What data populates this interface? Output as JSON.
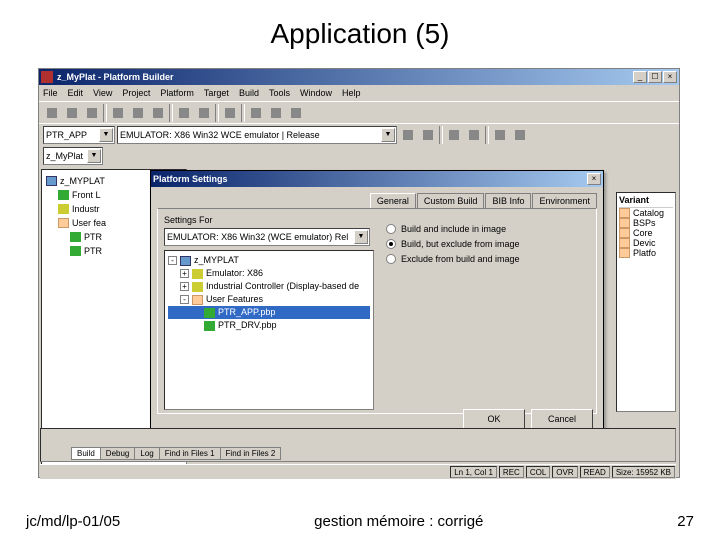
{
  "slide": {
    "title": "Application (5)"
  },
  "footer": {
    "left": "jc/md/lp-01/05",
    "center": "gestion mémoire : corrigé",
    "right": "27"
  },
  "window": {
    "title": "z_MyPlat - Platform Builder",
    "min": "_",
    "max": "☐",
    "close": "×"
  },
  "menu": [
    "File",
    "Edit",
    "View",
    "Project",
    "Platform",
    "Target",
    "Build",
    "Tools",
    "Window",
    "Help"
  ],
  "row2": {
    "left": "PTR_APP",
    "right": "EMULATOR: X86 Win32 WCE emulator | Release"
  },
  "row3": {
    "combo": "z_MyPlat"
  },
  "leftTree": [
    {
      "cls": "",
      "icon": "box",
      "label": "z_MYPLAT"
    },
    {
      "cls": "ind1",
      "icon": "green",
      "label": "Front L"
    },
    {
      "cls": "ind1",
      "icon": "yellow",
      "label": "Industr"
    },
    {
      "cls": "ind1",
      "icon": "folder",
      "label": "User fea"
    },
    {
      "cls": "ind2",
      "icon": "green",
      "label": "PTR"
    },
    {
      "cls": "ind2",
      "icon": "green",
      "label": "PTR"
    }
  ],
  "rightPane": {
    "header": "Variant",
    "items": [
      "Catalog",
      "BSPs",
      "Core",
      "Devic",
      "Platfo"
    ]
  },
  "dialog": {
    "title": "Platform Settings",
    "close": "×",
    "tabs": [
      "General",
      "Custom Build",
      "BIB Info",
      "Environment"
    ],
    "activeTab": 0,
    "settingsForLabel": "Settings For",
    "settingsForCombo": "EMULATOR: X86 Win32 (WCE emulator) Rel",
    "tree": [
      {
        "pm": "-",
        "cls": "",
        "icon": "box",
        "label": "z_MYPLAT",
        "sel": false
      },
      {
        "pm": "+",
        "cls": "ind1",
        "icon": "yellow",
        "label": "Emulator: X86",
        "sel": false
      },
      {
        "pm": "+",
        "cls": "ind1",
        "icon": "yellow",
        "label": "Industrial Controller (Display-based de",
        "sel": false
      },
      {
        "pm": "-",
        "cls": "ind1",
        "icon": "folder",
        "label": "User Features",
        "sel": false
      },
      {
        "pm": "",
        "cls": "ind2",
        "icon": "green",
        "label": "PTR_APP.pbp",
        "sel": true
      },
      {
        "pm": "",
        "cls": "ind2",
        "icon": "green",
        "label": "PTR_DRV.pbp",
        "sel": false
      }
    ],
    "radios": [
      {
        "label": "Build and include in image",
        "sel": false
      },
      {
        "label": "Build, but exclude from image",
        "sel": true
      },
      {
        "label": "Exclude from build and image",
        "sel": false
      }
    ],
    "ok": "OK",
    "cancel": "Cancel"
  },
  "bottomTabs": [
    "Build",
    "Debug",
    "Log",
    "Find in Files 1",
    "Find in Files 2"
  ],
  "status": {
    "lncol": "Ln 1, Col 1",
    "rec": "REC",
    "col": "COL",
    "ovr": "OVR",
    "read": "READ",
    "size": "Size: 15952 KB"
  }
}
